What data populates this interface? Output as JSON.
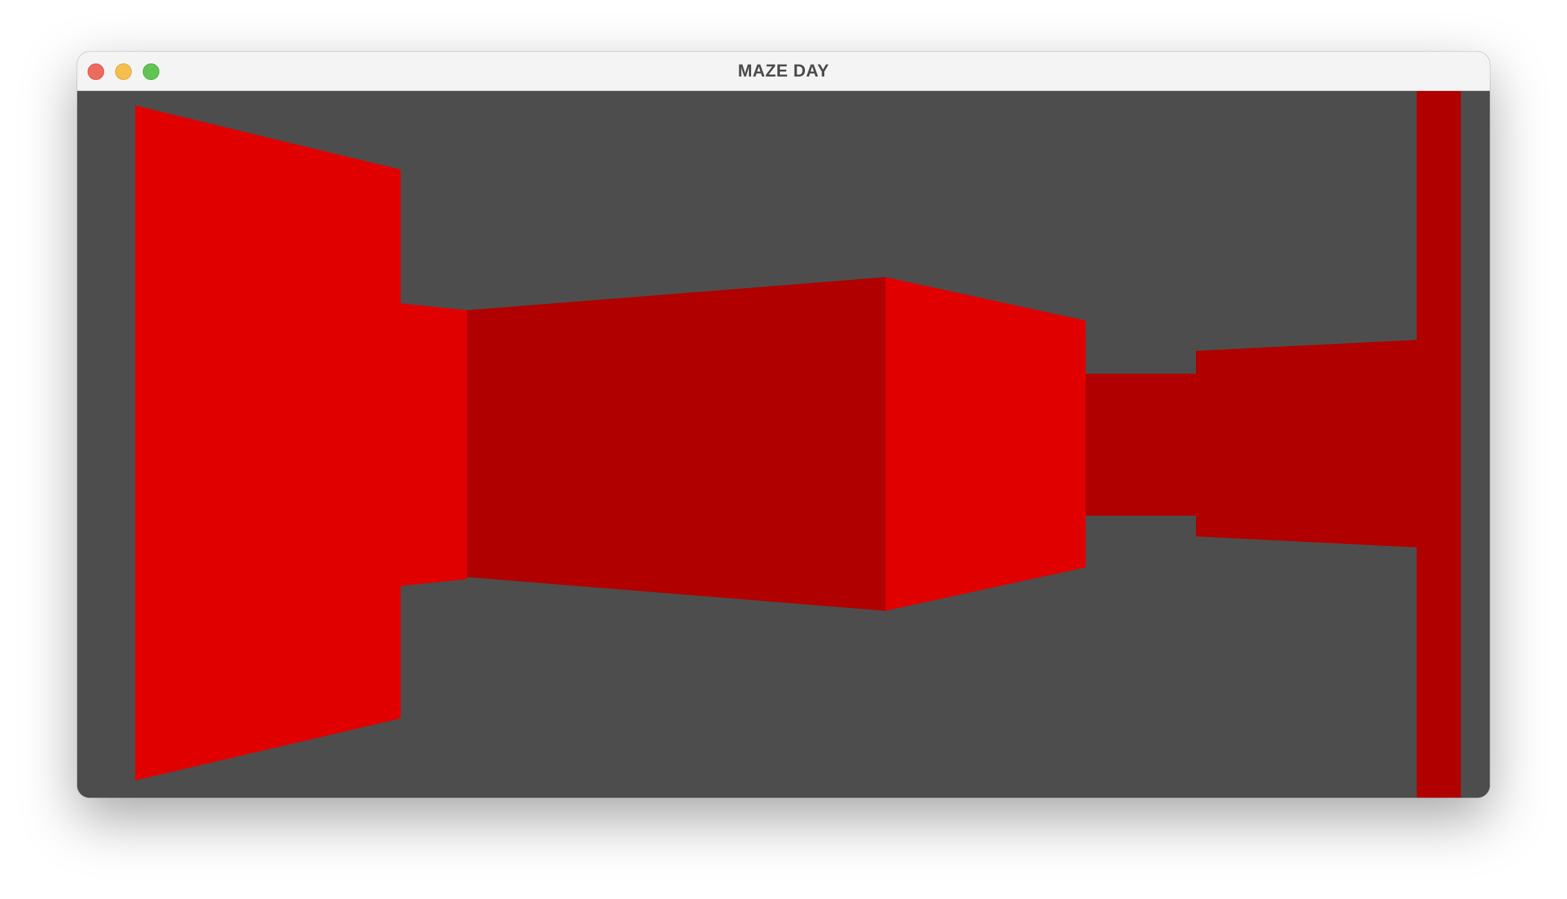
{
  "window": {
    "title": "MAZE DAY"
  },
  "colors": {
    "background": "#4d4d4d",
    "wall_lit": "#e10000",
    "wall_shaded": "#b00000",
    "titlebar": "#f4f4f4",
    "title_text": "#4a4a4a",
    "traffic_close": "#ed6a5e",
    "traffic_minimize": "#f5bf4f",
    "traffic_zoom": "#61c554"
  },
  "icons": {
    "close": "close-icon",
    "minimize": "minimize-icon",
    "zoom": "zoom-icon"
  }
}
